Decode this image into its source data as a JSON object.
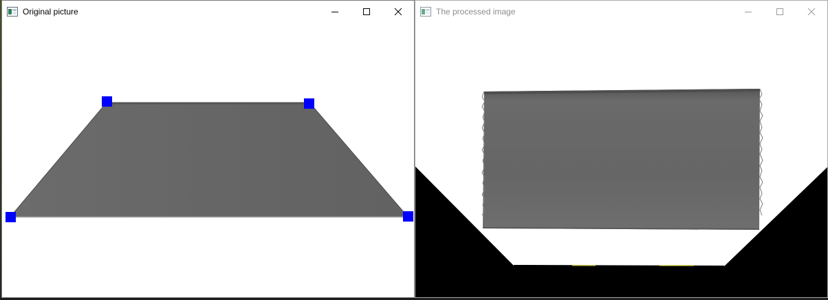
{
  "windows": {
    "original": {
      "title": "Original picture",
      "controls": {
        "minimize": "minimize",
        "maximize": "maximize",
        "close": "close"
      }
    },
    "processed": {
      "title": "The processed image",
      "controls": {
        "minimize": "minimize",
        "maximize": "maximize",
        "close": "close"
      }
    }
  },
  "colors": {
    "marker": "#0000ff",
    "shape_fill": "#6a6a6a",
    "warp_background": "#000000",
    "canvas": "#ffffff"
  },
  "icons": [
    "app-icon",
    "minimize-icon",
    "maximize-icon",
    "close-icon"
  ]
}
